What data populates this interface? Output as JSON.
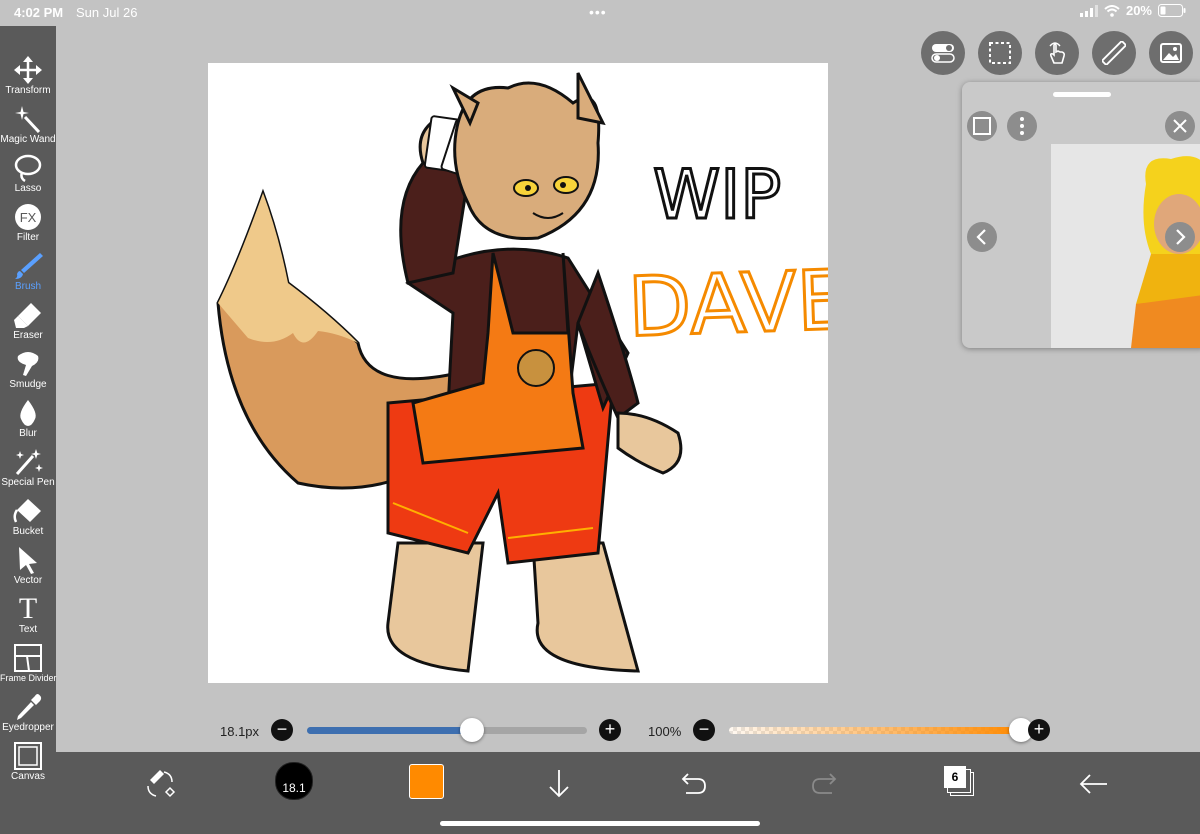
{
  "status": {
    "time": "4:02 PM",
    "date": "Sun Jul 26",
    "battery": "20%"
  },
  "tools": [
    {
      "label": "Transform",
      "icon": "transform-icon"
    },
    {
      "label": "Magic Wand",
      "icon": "magic-wand-icon"
    },
    {
      "label": "Lasso",
      "icon": "lasso-icon"
    },
    {
      "label": "Filter",
      "icon": "fx-icon"
    },
    {
      "label": "Brush",
      "icon": "brush-icon"
    },
    {
      "label": "Eraser",
      "icon": "eraser-icon"
    },
    {
      "label": "Smudge",
      "icon": "smudge-icon"
    },
    {
      "label": "Blur",
      "icon": "blur-drop-icon"
    },
    {
      "label": "Special Pen",
      "icon": "special-pen-icon"
    },
    {
      "label": "Bucket",
      "icon": "bucket-icon"
    },
    {
      "label": "Vector",
      "icon": "vector-arrow-icon"
    },
    {
      "label": "Text",
      "icon": "text-icon"
    },
    {
      "label": "Frame Divider",
      "icon": "frame-divider-icon"
    },
    {
      "label": "Eyedropper",
      "icon": "eyedropper-icon"
    },
    {
      "label": "Canvas",
      "icon": "canvas-icon"
    }
  ],
  "active_tool": "Brush",
  "filter_icon_text": "FX",
  "text_icon_glyph": "T",
  "artwork": {
    "title_line1": "WIP",
    "title_line2": "DAVE"
  },
  "brush_size": {
    "label": "18.1px",
    "level": 0.59
  },
  "opacity": {
    "label": "100%",
    "level": 1.0
  },
  "bottom": {
    "brush_size_badge": "18.1",
    "current_color": "#ff8a00",
    "layer_count": "6"
  },
  "colors": {
    "accent": "#5aa0ff",
    "slider_blue": "#3d6fb0"
  }
}
